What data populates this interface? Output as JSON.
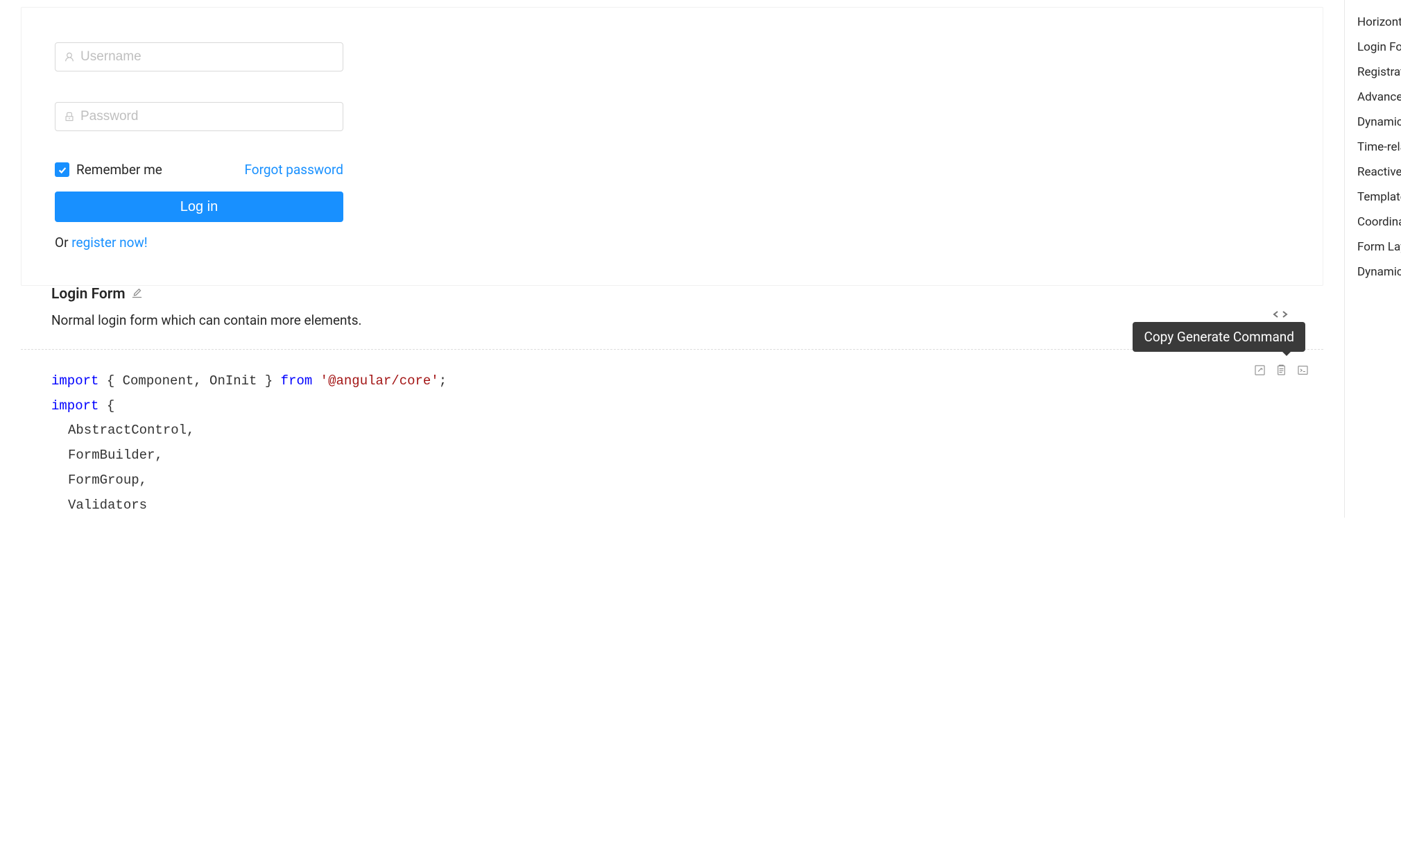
{
  "form": {
    "username_placeholder": "Username",
    "password_placeholder": "Password",
    "remember_label": "Remember me",
    "forgot_label": "Forgot password",
    "login_label": "Log in",
    "register_prefix": "Or ",
    "register_link": "register now!"
  },
  "section": {
    "title": "Login Form",
    "description": "Normal login form which can contain more elements."
  },
  "tooltip": {
    "text": "Copy Generate Command"
  },
  "code": {
    "line1_kw": "import",
    "line1_mid": " { Component, OnInit } ",
    "line1_from": "from",
    "line1_str": " '@angular/core'",
    "line1_end": ";",
    "line2_kw": "import",
    "line2_mid": " {",
    "line3": "AbstractControl,",
    "line4": "FormBuilder,",
    "line5": "FormGroup,",
    "line6": "Validators"
  },
  "sidebar": {
    "items": [
      "Horizontal Login Form",
      "Login Form",
      "Registration",
      "Advanced search",
      "Dynamic Form Item",
      "Time-related Controls",
      "Reactive Forms",
      "Template-driven Forms",
      "Coordinated Controls",
      "Form Layout",
      "Dynamic Rules"
    ]
  }
}
